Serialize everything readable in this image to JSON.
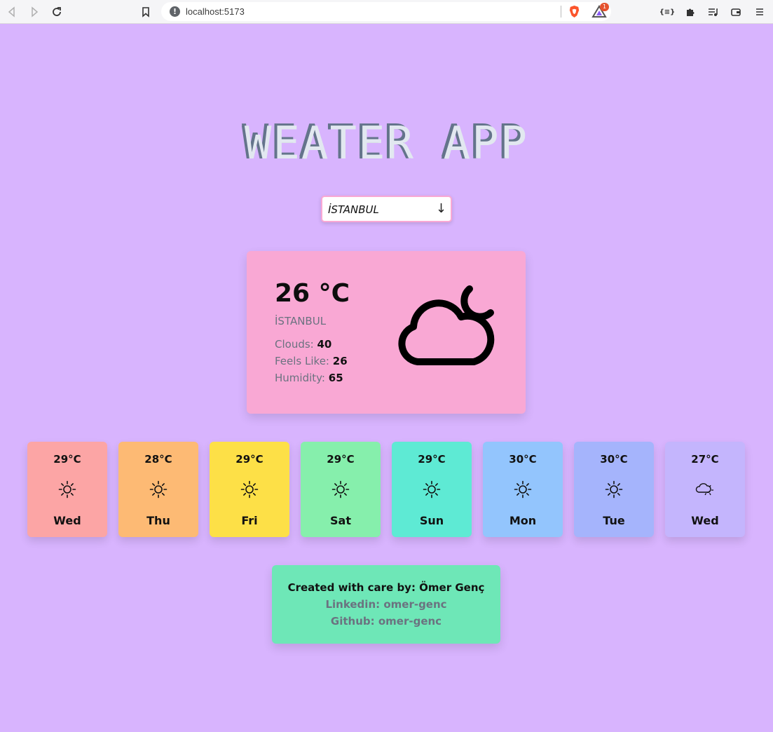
{
  "browser": {
    "url": "localhost:5173",
    "rewards_badge": "1"
  },
  "app": {
    "title": "WEATER APP"
  },
  "city_select": {
    "value": "İSTANBUL",
    "arrow": "↓"
  },
  "current": {
    "temp": "26 °C",
    "city": "İSTANBUL",
    "clouds_label": "Clouds:",
    "clouds_value": "40",
    "feels_label": "Feels Like:",
    "feels_value": "26",
    "humidity_label": "Humidity:",
    "humidity_value": "65",
    "icon": "cloud-moon-icon"
  },
  "forecast": [
    {
      "temp": "29°C",
      "day": "Wed",
      "icon": "sun-icon",
      "color": "#fca5a5"
    },
    {
      "temp": "28°C",
      "day": "Thu",
      "icon": "sun-icon",
      "color": "#fdba74"
    },
    {
      "temp": "29°C",
      "day": "Fri",
      "icon": "sun-icon",
      "color": "#fde047"
    },
    {
      "temp": "29°C",
      "day": "Sat",
      "icon": "sun-icon",
      "color": "#86efac"
    },
    {
      "temp": "29°C",
      "day": "Sun",
      "icon": "sun-icon",
      "color": "#5eead4"
    },
    {
      "temp": "30°C",
      "day": "Mon",
      "icon": "sun-icon",
      "color": "#93c5fd"
    },
    {
      "temp": "30°C",
      "day": "Tue",
      "icon": "sun-icon",
      "color": "#a5b4fc"
    },
    {
      "temp": "27°C",
      "day": "Wed",
      "icon": "cloud-sun-icon",
      "color": "#c4b5fd"
    }
  ],
  "footer": {
    "created": "Created with care by: Ömer Genç",
    "linkedin": "Linkedin: omer-genc",
    "github": "Github: omer-genc"
  },
  "colors": {
    "background": "#d8b4fe",
    "current_card": "#f9a8d4",
    "footer_card": "#6ee7b7"
  }
}
